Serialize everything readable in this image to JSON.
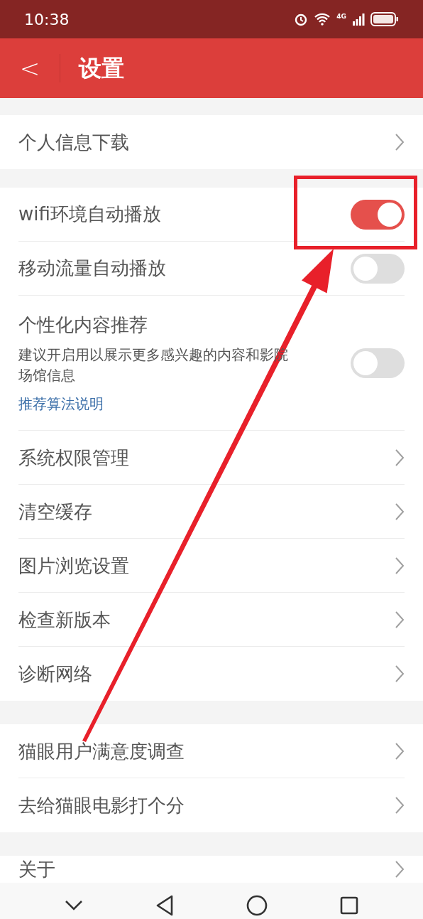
{
  "status_bar": {
    "time": "10:38",
    "network": "4G"
  },
  "header": {
    "back": "<",
    "title": "设置"
  },
  "sections": [
    {
      "items": [
        {
          "kind": "link",
          "label": "个人信息下载"
        }
      ]
    },
    {
      "items": [
        {
          "kind": "toggle",
          "label": "wifi环境自动播放",
          "on": true
        },
        {
          "kind": "toggle",
          "label": "移动流量自动播放",
          "on": false
        },
        {
          "kind": "toggle",
          "label": "个性化内容推荐",
          "description": "建议开启用以展示更多感兴趣的内容和影院场馆信息",
          "link": "推荐算法说明",
          "on": false
        },
        {
          "kind": "link",
          "label": "系统权限管理"
        },
        {
          "kind": "link",
          "label": "清空缓存"
        },
        {
          "kind": "link",
          "label": "图片浏览设置"
        },
        {
          "kind": "link",
          "label": "检查新版本"
        },
        {
          "kind": "link",
          "label": "诊断网络"
        }
      ]
    },
    {
      "items": [
        {
          "kind": "link",
          "label": "猫眼用户满意度调查"
        },
        {
          "kind": "link",
          "label": "去给猫眼电影打个分"
        }
      ]
    },
    {
      "items": [
        {
          "kind": "link",
          "label": "关于"
        }
      ]
    }
  ]
}
